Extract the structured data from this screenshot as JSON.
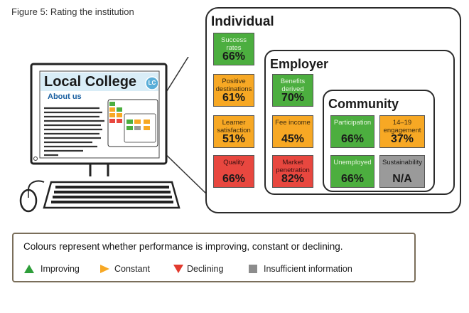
{
  "figure_title": "Figure 5: Rating the institution",
  "monitor": {
    "site_title": "Local College",
    "logo_text": "LC",
    "link": "About us"
  },
  "panels": {
    "individual": {
      "title": "Individual",
      "tiles": [
        {
          "label": "Success rates",
          "value": "66%",
          "status": "improving"
        },
        {
          "label": "Positive destinations",
          "value": "61%",
          "status": "constant"
        },
        {
          "label": "Learner satisfaction",
          "value": "51%",
          "status": "constant"
        },
        {
          "label": "Quality",
          "value": "66%",
          "status": "declining"
        }
      ]
    },
    "employer": {
      "title": "Employer",
      "tiles": [
        {
          "label": "Benefits derived",
          "value": "70%",
          "status": "improving"
        },
        {
          "label": "Fee income",
          "value": "45%",
          "status": "constant"
        },
        {
          "label": "Market penetration",
          "value": "82%",
          "status": "declining"
        }
      ]
    },
    "community": {
      "title": "Community",
      "tiles": [
        {
          "label": "Participation",
          "value": "66%",
          "status": "improving"
        },
        {
          "label": "14–19 engagement",
          "value": "37%",
          "status": "constant"
        },
        {
          "label": "Unemployed",
          "value": "66%",
          "status": "improving"
        },
        {
          "label": "Sustainability",
          "value": "N/A",
          "status": "insufficient"
        }
      ]
    }
  },
  "legend": {
    "text": "Colours represent whether performance is improving, constant or declining.",
    "items": [
      {
        "label": "Improving",
        "color": "#2e9e3a",
        "icon": "triangle-up-icon"
      },
      {
        "label": "Constant",
        "color": "#f7a824",
        "icon": "triangle-right-icon"
      },
      {
        "label": "Declining",
        "color": "#e23a2e",
        "icon": "triangle-down-icon"
      },
      {
        "label": "Insufficient information",
        "color": "#8c8c8c",
        "icon": "square-icon"
      }
    ]
  },
  "colors": {
    "improving": "#4cae3f",
    "constant": "#f7a824",
    "declining": "#e8473f",
    "insufficient": "#9a9a9a"
  }
}
